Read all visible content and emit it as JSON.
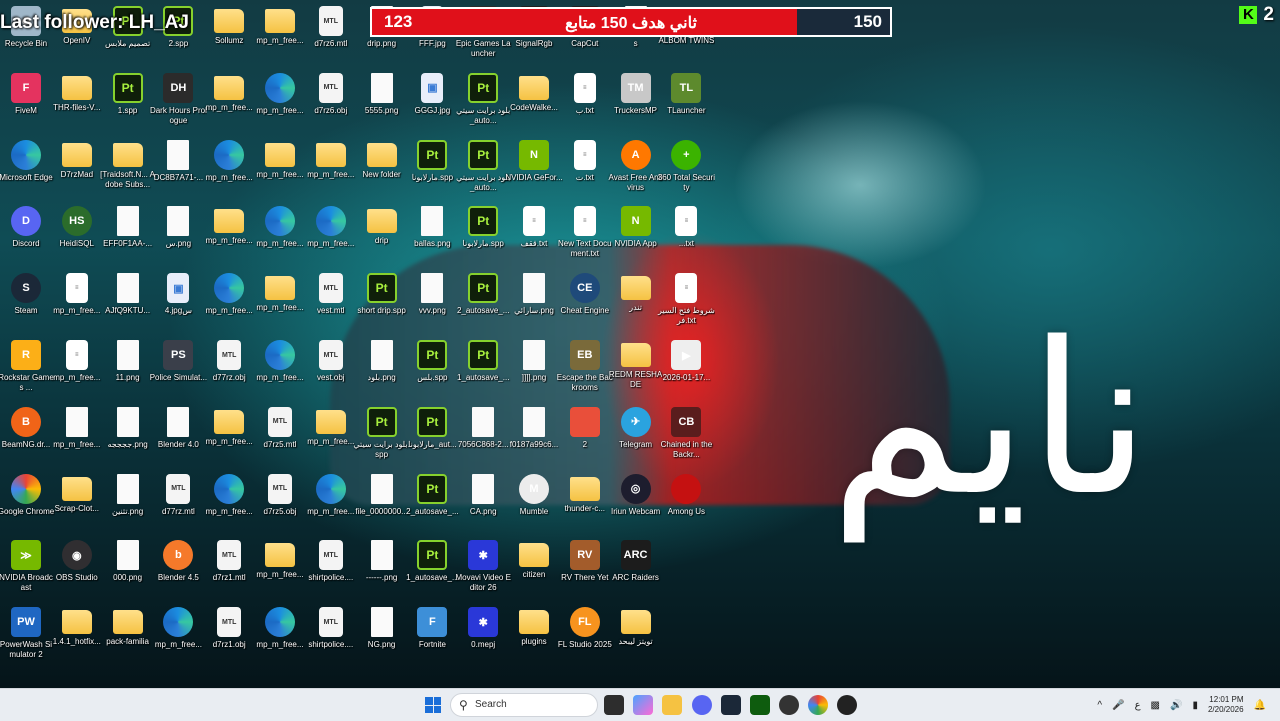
{
  "overlay": {
    "last_follower": "Last follower: LH_AJ",
    "goal_current": "123",
    "goal_title": "ثاني هدف 150 متابع",
    "goal_target": "150",
    "goal_progress_fraction": 0.82,
    "kick_logo": "K",
    "kick_count": "2",
    "wallpaper_text": "نايم"
  },
  "desktop": {
    "icons": [
      {
        "label": "Recycle Bin",
        "type": "bin",
        "col": 0,
        "row": 0
      },
      {
        "label": "OpenIV",
        "type": "folder",
        "col": 1,
        "row": 0
      },
      {
        "label": "تصميم ملابس",
        "type": "spp",
        "col": 2,
        "row": 0
      },
      {
        "label": "2.spp",
        "type": "spp",
        "col": 3,
        "row": 0
      },
      {
        "label": "Sollumz",
        "type": "folder",
        "col": 4,
        "row": 0
      },
      {
        "label": "mp_m_free...",
        "type": "folder",
        "col": 5,
        "row": 0
      },
      {
        "label": "d7rz6.mtl",
        "type": "mtl",
        "col": 6,
        "row": 0
      },
      {
        "label": "drip.png",
        "type": "file",
        "col": 7,
        "row": 0
      },
      {
        "label": "FFF.jpg",
        "type": "img",
        "col": 8,
        "row": 0
      },
      {
        "label": "Epic Games Launcher",
        "type": "epic",
        "col": 9,
        "row": 0
      },
      {
        "label": "SignalRgb",
        "type": "app",
        "col": 10,
        "row": 0
      },
      {
        "label": "CapCut",
        "type": "app",
        "col": 11,
        "row": 0
      },
      {
        "label": "s",
        "type": "file",
        "col": 12,
        "row": 0
      },
      {
        "label": "ALBOM TWINS",
        "type": "folder",
        "col": 13,
        "row": 0
      },
      {
        "label": "FiveM",
        "type": "fivem",
        "col": 0,
        "row": 1
      },
      {
        "label": "THR-files-V...",
        "type": "folder",
        "col": 1,
        "row": 1
      },
      {
        "label": "1.spp",
        "type": "spp",
        "col": 2,
        "row": 1
      },
      {
        "label": "Dark Hours Prologue",
        "type": "dark",
        "col": 3,
        "row": 1
      },
      {
        "label": "mp_m_free...",
        "type": "folder",
        "col": 4,
        "row": 1
      },
      {
        "label": "mp_m_free...",
        "type": "edge",
        "col": 5,
        "row": 1
      },
      {
        "label": "d7rz6.obj",
        "type": "mtl",
        "col": 6,
        "row": 1
      },
      {
        "label": "5555.png",
        "type": "file",
        "col": 7,
        "row": 1
      },
      {
        "label": "GGGJ.jpg",
        "type": "img",
        "col": 8,
        "row": 1
      },
      {
        "label": "بلود برايت سيتي_auto...",
        "type": "spp",
        "col": 9,
        "row": 1
      },
      {
        "label": "CodeWalke...",
        "type": "folder",
        "col": 10,
        "row": 1
      },
      {
        "label": "ب.txt",
        "type": "txt",
        "col": 11,
        "row": 1
      },
      {
        "label": "TruckersMP",
        "type": "truck",
        "col": 12,
        "row": 1
      },
      {
        "label": "TLauncher",
        "type": "tl",
        "col": 13,
        "row": 1
      },
      {
        "label": "Microsoft Edge",
        "type": "edge",
        "col": 0,
        "row": 2
      },
      {
        "label": "D7rzMad",
        "type": "folder",
        "col": 1,
        "row": 2
      },
      {
        "label": "[Traidsoft.N... Adobe Subs...",
        "type": "folder",
        "col": 2,
        "row": 2
      },
      {
        "label": "DC8B7A71-...",
        "type": "file",
        "col": 3,
        "row": 2
      },
      {
        "label": "mp_m_free...",
        "type": "edge",
        "col": 4,
        "row": 2
      },
      {
        "label": "mp_m_free...",
        "type": "folder",
        "col": 5,
        "row": 2
      },
      {
        "label": "mp_m_free...",
        "type": "folder",
        "col": 6,
        "row": 2
      },
      {
        "label": "New folder",
        "type": "folder",
        "col": 7,
        "row": 2
      },
      {
        "label": "مارلابونا.spp",
        "type": "spp",
        "col": 8,
        "row": 2
      },
      {
        "label": "بلود برايت سيتي_auto...",
        "type": "spp",
        "col": 9,
        "row": 2
      },
      {
        "label": "NVIDIA GeFor...",
        "type": "nvidia",
        "col": 10,
        "row": 2
      },
      {
        "label": "ت.txt",
        "type": "txt",
        "col": 11,
        "row": 2
      },
      {
        "label": "Avast Free Antivirus",
        "type": "avast",
        "col": 12,
        "row": 2
      },
      {
        "label": "360 Total Security",
        "type": "t360",
        "col": 13,
        "row": 2
      },
      {
        "label": "Discord",
        "type": "discord",
        "col": 0,
        "row": 3
      },
      {
        "label": "HeidiSQL",
        "type": "heidi",
        "col": 1,
        "row": 3
      },
      {
        "label": "EFF0F1AA-...",
        "type": "file",
        "col": 2,
        "row": 3
      },
      {
        "label": "س.png",
        "type": "file",
        "col": 3,
        "row": 3
      },
      {
        "label": "mp_m_free...",
        "type": "folder",
        "col": 4,
        "row": 3
      },
      {
        "label": "mp_m_free...",
        "type": "edge",
        "col": 5,
        "row": 3
      },
      {
        "label": "mp_m_free...",
        "type": "edge",
        "col": 6,
        "row": 3
      },
      {
        "label": "drip",
        "type": "folder",
        "col": 7,
        "row": 3
      },
      {
        "label": "ballas.png",
        "type": "file",
        "col": 8,
        "row": 3
      },
      {
        "label": "مارلابونا.spp",
        "type": "spp",
        "col": 9,
        "row": 3
      },
      {
        "label": "ققف.txt",
        "type": "txt",
        "col": 10,
        "row": 3
      },
      {
        "label": "New Text Document.txt",
        "type": "txt",
        "col": 11,
        "row": 3
      },
      {
        "label": "NVIDIA App",
        "type": "nvidia",
        "col": 12,
        "row": 3
      },
      {
        "label": "...txt",
        "type": "txt",
        "col": 13,
        "row": 3
      },
      {
        "label": "Steam",
        "type": "steam",
        "col": 0,
        "row": 4
      },
      {
        "label": "mp_m_free...",
        "type": "txt",
        "col": 1,
        "row": 4
      },
      {
        "label": "AJfQ9KTU...",
        "type": "file",
        "col": 2,
        "row": 4
      },
      {
        "label": "4.jpgس",
        "type": "img",
        "col": 3,
        "row": 4
      },
      {
        "label": "mp_m_free...",
        "type": "edge",
        "col": 4,
        "row": 4
      },
      {
        "label": "mp_m_free...",
        "type": "folder",
        "col": 5,
        "row": 4
      },
      {
        "label": "vest.mtl",
        "type": "mtl",
        "col": 6,
        "row": 4
      },
      {
        "label": "short drip.spp",
        "type": "spp",
        "col": 7,
        "row": 4
      },
      {
        "label": "vvv.png",
        "type": "file",
        "col": 8,
        "row": 4
      },
      {
        "label": "2_autosave_...",
        "type": "spp",
        "col": 9,
        "row": 4
      },
      {
        "label": "سارائي.png",
        "type": "file",
        "col": 10,
        "row": 4
      },
      {
        "label": "Cheat Engine",
        "type": "cheat",
        "col": 11,
        "row": 4
      },
      {
        "label": "تندر",
        "type": "folder",
        "col": 12,
        "row": 4
      },
      {
        "label": "شروط فتح السيرفر.txt",
        "type": "txt",
        "col": 13,
        "row": 4
      },
      {
        "label": "Rockstar Games ...",
        "type": "rockstar",
        "col": 0,
        "row": 5
      },
      {
        "label": "mp_m_free...",
        "type": "txt",
        "col": 1,
        "row": 5
      },
      {
        "label": "11.png",
        "type": "file",
        "col": 2,
        "row": 5
      },
      {
        "label": "Police Simulat...",
        "type": "police",
        "col": 3,
        "row": 5
      },
      {
        "label": "d77rz.obj",
        "type": "mtl",
        "col": 4,
        "row": 5
      },
      {
        "label": "mp_m_free...",
        "type": "edge",
        "col": 5,
        "row": 5
      },
      {
        "label": "vest.obj",
        "type": "mtl",
        "col": 6,
        "row": 5
      },
      {
        "label": "بلود.png",
        "type": "file",
        "col": 7,
        "row": 5
      },
      {
        "label": "بلس.spp",
        "type": "spp",
        "col": 8,
        "row": 5
      },
      {
        "label": "1_autosave_...",
        "type": "spp",
        "col": 9,
        "row": 5
      },
      {
        "label": "]]]].png",
        "type": "file",
        "col": 10,
        "row": 5
      },
      {
        "label": "Escape the Backrooms",
        "type": "backrooms",
        "col": 11,
        "row": 5
      },
      {
        "label": "REDM RESHADE",
        "type": "folder",
        "col": 12,
        "row": 5
      },
      {
        "label": "2026-01-17...",
        "type": "video",
        "col": 13,
        "row": 5
      },
      {
        "label": "BeamNG.dr...",
        "type": "beam",
        "col": 0,
        "row": 6
      },
      {
        "label": "mp_m_free...",
        "type": "file",
        "col": 1,
        "row": 6
      },
      {
        "label": "ججججه.png",
        "type": "file",
        "col": 2,
        "row": 6
      },
      {
        "label": "Blender 4.0",
        "type": "file",
        "col": 3,
        "row": 6
      },
      {
        "label": "mp_m_free...",
        "type": "folder",
        "col": 4,
        "row": 6
      },
      {
        "label": "d7rz5.mtl",
        "type": "mtl",
        "col": 5,
        "row": 6
      },
      {
        "label": "mp_m_free...",
        "type": "folder",
        "col": 6,
        "row": 6
      },
      {
        "label": "بلود برايت سيتي.spp",
        "type": "spp",
        "col": 7,
        "row": 6
      },
      {
        "label": "مارلابونا_aut...",
        "type": "spp",
        "col": 8,
        "row": 6
      },
      {
        "label": "7056C868-2...",
        "type": "file",
        "col": 9,
        "row": 6
      },
      {
        "label": "f0187a99c6...",
        "type": "file",
        "col": 10,
        "row": 6
      },
      {
        "label": "2",
        "type": "redfolder",
        "col": 11,
        "row": 6
      },
      {
        "label": "Telegram",
        "type": "telegram",
        "col": 12,
        "row": 6
      },
      {
        "label": "Chained in the Backr...",
        "type": "chained",
        "col": 13,
        "row": 6
      },
      {
        "label": "Google Chrome",
        "type": "chrome",
        "col": 0,
        "row": 7
      },
      {
        "label": "Scrap-Clot...",
        "type": "folder",
        "col": 1,
        "row": 7
      },
      {
        "label": "تثنين.png",
        "type": "file",
        "col": 2,
        "row": 7
      },
      {
        "label": "d77rz.mtl",
        "type": "mtl",
        "col": 3,
        "row": 7
      },
      {
        "label": "mp_m_free...",
        "type": "edge",
        "col": 4,
        "row": 7
      },
      {
        "label": "d7rz5.obj",
        "type": "mtl",
        "col": 5,
        "row": 7
      },
      {
        "label": "mp_m_free...",
        "type": "edge",
        "col": 6,
        "row": 7
      },
      {
        "label": "file_0000000...",
        "type": "file",
        "col": 7,
        "row": 7
      },
      {
        "label": "2_autosave_...",
        "type": "spp",
        "col": 8,
        "row": 7
      },
      {
        "label": "CA.png",
        "type": "file",
        "col": 9,
        "row": 7
      },
      {
        "label": "Mumble",
        "type": "mumble",
        "col": 10,
        "row": 7
      },
      {
        "label": "thunder-c...",
        "type": "folder",
        "col": 11,
        "row": 7
      },
      {
        "label": "Iriun Webcam",
        "type": "iriun",
        "col": 12,
        "row": 7
      },
      {
        "label": "Among Us",
        "type": "among",
        "col": 13,
        "row": 7
      },
      {
        "label": "NVIDIA Broadcast",
        "type": "nvbroad",
        "col": 0,
        "row": 8
      },
      {
        "label": "OBS Studio",
        "type": "obs",
        "col": 1,
        "row": 8
      },
      {
        "label": "000.png",
        "type": "file",
        "col": 2,
        "row": 8
      },
      {
        "label": "Blender 4.5",
        "type": "blender",
        "col": 3,
        "row": 8
      },
      {
        "label": "d7rz1.mtl",
        "type": "mtl",
        "col": 4,
        "row": 8
      },
      {
        "label": "mp_m_free...",
        "type": "folder",
        "col": 5,
        "row": 8
      },
      {
        "label": "shirtpolice....",
        "type": "mtl",
        "col": 6,
        "row": 8
      },
      {
        "label": "------.png",
        "type": "file",
        "col": 7,
        "row": 8
      },
      {
        "label": "1_autosave_...",
        "type": "spp",
        "col": 8,
        "row": 8
      },
      {
        "label": "Movavi Video Editor 26",
        "type": "movavi",
        "col": 9,
        "row": 8
      },
      {
        "label": "citizen",
        "type": "folder",
        "col": 10,
        "row": 8
      },
      {
        "label": "RV There Yet",
        "type": "rv",
        "col": 11,
        "row": 8
      },
      {
        "label": "ARC Raiders",
        "type": "arc",
        "col": 12,
        "row": 8
      },
      {
        "label": "PowerWash Simulator 2",
        "type": "powerwash",
        "col": 0,
        "row": 9
      },
      {
        "label": "1.4.1_hotfix...",
        "type": "folder",
        "col": 1,
        "row": 9
      },
      {
        "label": "pack-familia",
        "type": "folder",
        "col": 2,
        "row": 9
      },
      {
        "label": "mp_m_free...",
        "type": "edge",
        "col": 3,
        "row": 9
      },
      {
        "label": "d7rz1.obj",
        "type": "mtl",
        "col": 4,
        "row": 9
      },
      {
        "label": "mp_m_free...",
        "type": "edge",
        "col": 5,
        "row": 9
      },
      {
        "label": "shirtpolice....",
        "type": "mtl",
        "col": 6,
        "row": 9
      },
      {
        "label": "NG.png",
        "type": "file",
        "col": 7,
        "row": 9
      },
      {
        "label": "Fortnite",
        "type": "fortnite",
        "col": 8,
        "row": 9
      },
      {
        "label": "0.mepj",
        "type": "movavi",
        "col": 9,
        "row": 9
      },
      {
        "label": "plugins",
        "type": "folder",
        "col": 10,
        "row": 9
      },
      {
        "label": "FL Studio 2025",
        "type": "fl",
        "col": 11,
        "row": 9
      },
      {
        "label": "تويتز ليبحد",
        "type": "folder",
        "col": 12,
        "row": 9
      }
    ]
  },
  "taskbar": {
    "search_placeholder": "Search",
    "clock_time": "12:01 PM",
    "clock_date": "2/20/2026",
    "lang": "ع"
  },
  "colors": {
    "goal_bar": "#e0101a",
    "kick_green": "#53fc18",
    "taskbar": "#e9edf2"
  }
}
